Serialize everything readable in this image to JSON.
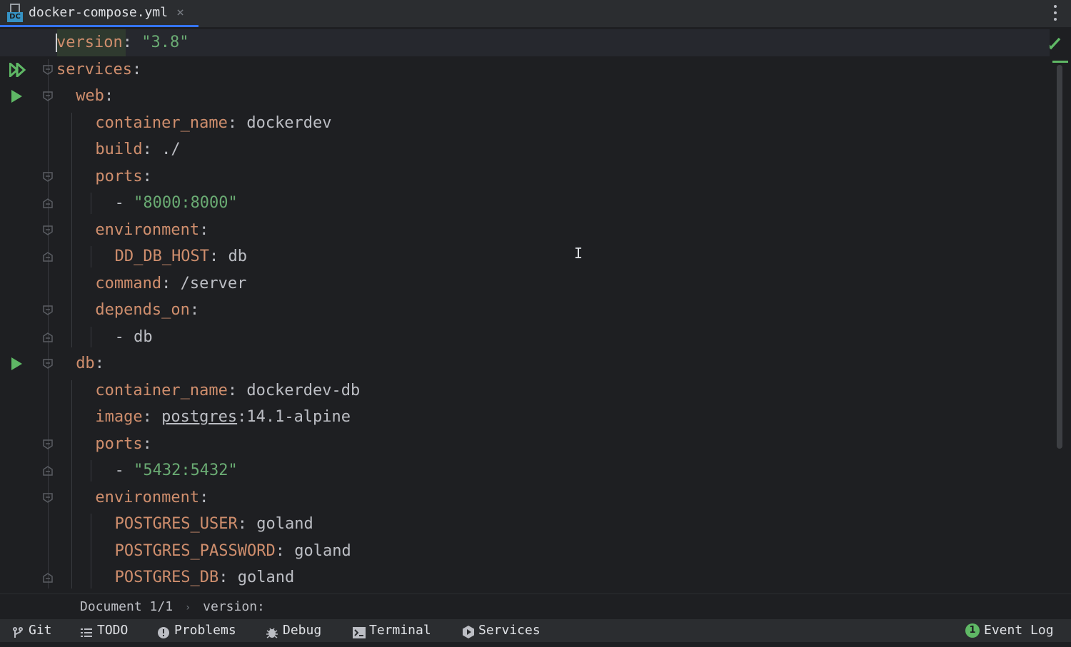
{
  "tab": {
    "filename": "docker-compose.yml",
    "icon": "docker-compose-file-icon",
    "icon_badge": "DC",
    "close_glyph": "×"
  },
  "code_lines": [
    {
      "indent": 0,
      "key": "version",
      "sep": ": ",
      "value": "\"3.8\"",
      "value_type": "string"
    },
    {
      "indent": 0,
      "key": "services",
      "sep": ":",
      "value": "",
      "value_type": "plain"
    },
    {
      "indent": 1,
      "key": "web",
      "sep": ":",
      "value": "",
      "value_type": "plain"
    },
    {
      "indent": 2,
      "key": "container_name",
      "sep": ": ",
      "value": "dockerdev",
      "value_type": "plain"
    },
    {
      "indent": 2,
      "key": "build",
      "sep": ": ",
      "value": "./",
      "value_type": "plain"
    },
    {
      "indent": 2,
      "key": "ports",
      "sep": ":",
      "value": "",
      "value_type": "plain"
    },
    {
      "indent": 3,
      "key": "- ",
      "sep": "",
      "value": "\"8000:8000\"",
      "value_type": "string",
      "is_list": true
    },
    {
      "indent": 2,
      "key": "environment",
      "sep": ":",
      "value": "",
      "value_type": "plain"
    },
    {
      "indent": 3,
      "key": "DD_DB_HOST",
      "sep": ": ",
      "value": "db",
      "value_type": "plain"
    },
    {
      "indent": 2,
      "key": "command",
      "sep": ": ",
      "value": "/server",
      "value_type": "plain"
    },
    {
      "indent": 2,
      "key": "depends_on",
      "sep": ":",
      "value": "",
      "value_type": "plain"
    },
    {
      "indent": 3,
      "key": "- ",
      "sep": "",
      "value": "db",
      "value_type": "plain",
      "is_list": true
    },
    {
      "indent": 1,
      "key": "db",
      "sep": ":",
      "value": "",
      "value_type": "plain"
    },
    {
      "indent": 2,
      "key": "container_name",
      "sep": ": ",
      "value": "dockerdev-db",
      "value_type": "plain"
    },
    {
      "indent": 2,
      "key": "image",
      "sep": ": ",
      "value_link": "postgres",
      "value": ":14.1-alpine",
      "value_type": "image"
    },
    {
      "indent": 2,
      "key": "ports",
      "sep": ":",
      "value": "",
      "value_type": "plain"
    },
    {
      "indent": 3,
      "key": "- ",
      "sep": "",
      "value": "\"5432:5432\"",
      "value_type": "string",
      "is_list": true
    },
    {
      "indent": 2,
      "key": "environment",
      "sep": ":",
      "value": "",
      "value_type": "plain"
    },
    {
      "indent": 3,
      "key": "POSTGRES_USER",
      "sep": ": ",
      "value": "goland",
      "value_type": "plain"
    },
    {
      "indent": 3,
      "key": "POSTGRES_PASSWORD",
      "sep": ": ",
      "value": "goland",
      "value_type": "plain"
    },
    {
      "indent": 3,
      "key": "POSTGRES_DB",
      "sep": ": ",
      "value": "goland",
      "value_type": "plain"
    }
  ],
  "gutter": {
    "run_all_lines": [
      1
    ],
    "run_lines": [
      2,
      12
    ],
    "fold_open_lines": [
      1,
      2,
      5,
      7,
      10,
      12,
      15,
      17
    ],
    "fold_close_lines": [
      6,
      8,
      11,
      16,
      20
    ]
  },
  "breadcrumb": {
    "items": [
      "Document 1/1",
      "version:"
    ],
    "separator": "›"
  },
  "toolbar": {
    "items": [
      {
        "label": "Git",
        "icon": "git-branch-icon"
      },
      {
        "label": "TODO",
        "icon": "list-icon"
      },
      {
        "label": "Problems",
        "icon": "problems-icon"
      },
      {
        "label": "Debug",
        "icon": "bug-icon"
      },
      {
        "label": "Terminal",
        "icon": "terminal-icon"
      },
      {
        "label": "Services",
        "icon": "services-icon"
      }
    ],
    "event_log": {
      "label": "Event Log",
      "count": "1"
    }
  },
  "colors": {
    "key": "#cf8e6d",
    "string": "#6aab73",
    "text": "#bcbec4",
    "background": "#1e1f22",
    "accent": "#3574f0",
    "run": "#5fb865"
  }
}
